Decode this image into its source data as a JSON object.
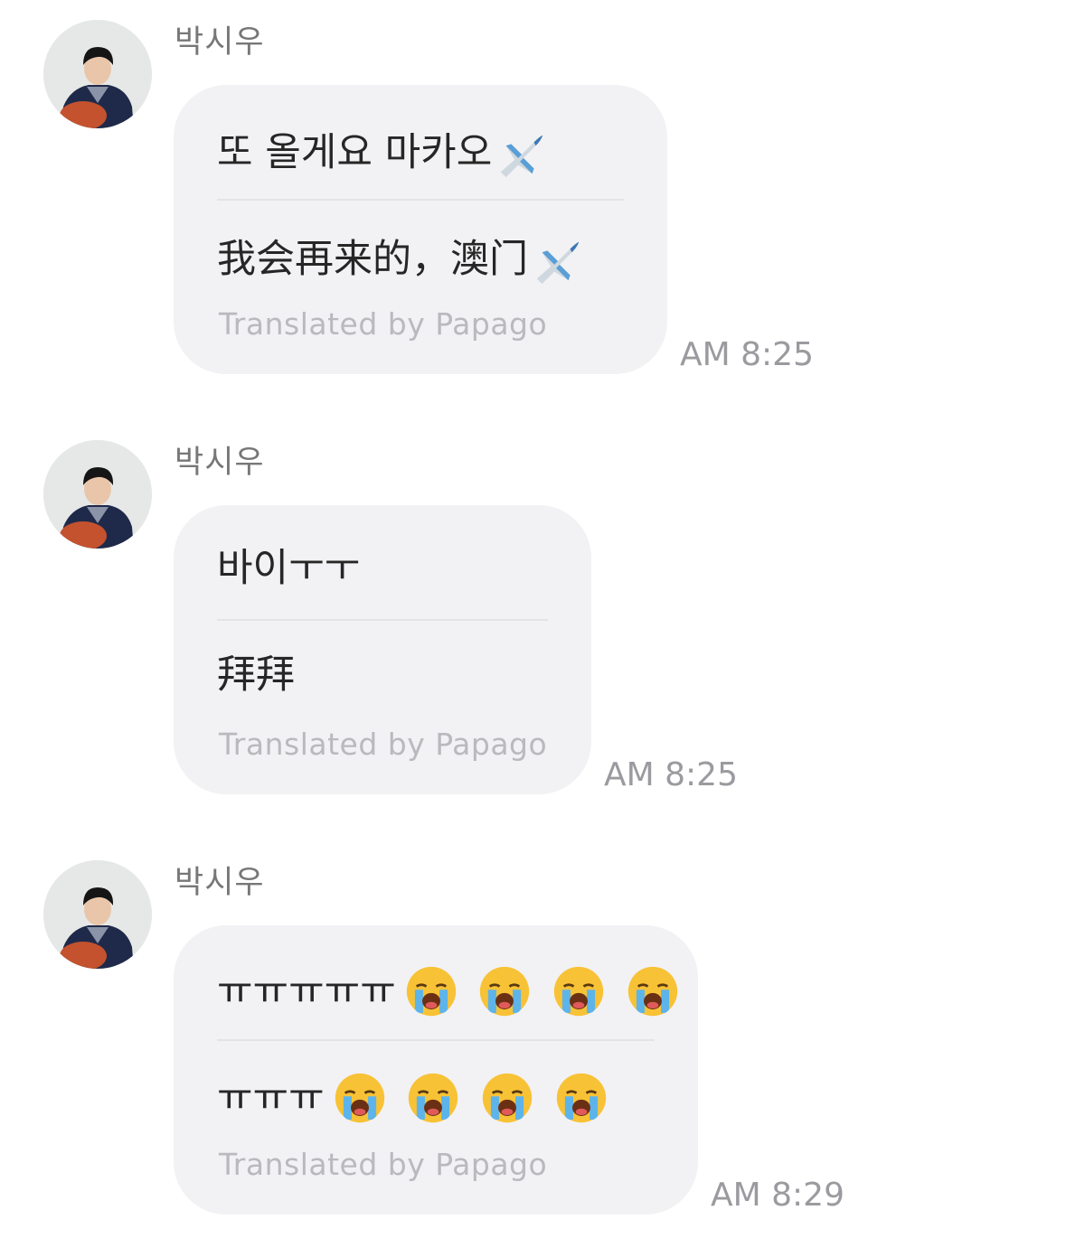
{
  "messages": [
    {
      "sender": "박시우",
      "original": "또 올게요 마카오",
      "translation": "我会再来的，澳门",
      "credit": "Translated by Papago",
      "time": "AM 8:25",
      "original_emoji": [
        "airplane-icon"
      ],
      "translation_emoji": [
        "airplane-icon"
      ]
    },
    {
      "sender": "박시우",
      "original": "바이ㅜㅜ",
      "translation": "拜拜",
      "credit": "Translated by Papago",
      "time": "AM 8:25",
      "original_emoji": [],
      "translation_emoji": []
    },
    {
      "sender": "박시우",
      "original": "ㅠㅠㅠㅠㅠ",
      "translation": "ㅠㅠㅠ",
      "credit": "Translated by Papago",
      "time": "AM 8:29",
      "original_emoji": [
        "loudly-crying-face-icon",
        "loudly-crying-face-icon",
        "loudly-crying-face-icon",
        "loudly-crying-face-icon"
      ],
      "translation_emoji": [
        "loudly-crying-face-icon",
        "loudly-crying-face-icon",
        "loudly-crying-face-icon",
        "loudly-crying-face-icon"
      ]
    }
  ],
  "colors": {
    "bubble": "#f2f2f4",
    "sender": "#777777",
    "time": "#9a9a9f",
    "credit": "#b9b9be",
    "text": "#262626"
  }
}
